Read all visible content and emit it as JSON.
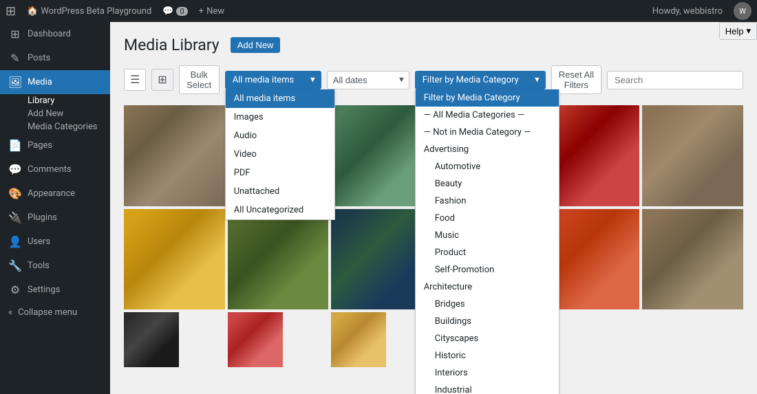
{
  "adminBar": {
    "siteIcon": "⊞",
    "siteName": "WordPress Beta Playground",
    "commentsLabel": "0",
    "newLabel": "New",
    "howdy": "Howdy, webbistro",
    "avatarInitial": "W"
  },
  "help": {
    "label": "Help",
    "arrow": "▾"
  },
  "page": {
    "title": "Media Library",
    "addNewLabel": "Add New"
  },
  "toolbar": {
    "listViewLabel": "≡",
    "gridViewLabel": "⊞",
    "bulkSelectLabel": "Bulk Select",
    "allMediaItems": "All media items",
    "allDates": "All dates",
    "filterByCategory": "Filter by Media Category",
    "resetFiltersLabel": "Reset All Filters",
    "searchPlaceholder": "Search"
  },
  "mediaItemsDropdown": {
    "items": [
      {
        "label": "All media items",
        "selected": true
      },
      {
        "label": "Images",
        "selected": false
      },
      {
        "label": "Audio",
        "selected": false
      },
      {
        "label": "Video",
        "selected": false
      },
      {
        "label": "PDF",
        "selected": false
      },
      {
        "label": "Unattached",
        "selected": false
      },
      {
        "label": "All Uncategorized",
        "selected": false
      }
    ]
  },
  "categoryDropdown": {
    "header": "Filter by Media Category",
    "items": [
      {
        "label": "— All Media Categories —",
        "type": "separator",
        "indent": false
      },
      {
        "label": "— Not in Media Category —",
        "type": "separator",
        "indent": false
      },
      {
        "label": "Advertising",
        "type": "category",
        "indent": false
      },
      {
        "label": "Automotive",
        "type": "category",
        "indent": true
      },
      {
        "label": "Beauty",
        "type": "category",
        "indent": true
      },
      {
        "label": "Fashion",
        "type": "category",
        "indent": true
      },
      {
        "label": "Food",
        "type": "category",
        "indent": true
      },
      {
        "label": "Music",
        "type": "category",
        "indent": true
      },
      {
        "label": "Product",
        "type": "category",
        "indent": true
      },
      {
        "label": "Self-Promotion",
        "type": "category",
        "indent": true
      },
      {
        "label": "Architecture",
        "type": "category",
        "indent": false
      },
      {
        "label": "Bridges",
        "type": "category",
        "indent": true
      },
      {
        "label": "Buildings",
        "type": "category",
        "indent": true
      },
      {
        "label": "Cityscapes",
        "type": "category",
        "indent": true
      },
      {
        "label": "Historic",
        "type": "category",
        "indent": true
      },
      {
        "label": "Interiors",
        "type": "category",
        "indent": true
      },
      {
        "label": "Industrial",
        "type": "category",
        "indent": true
      }
    ]
  },
  "sidebar": {
    "items": [
      {
        "label": "Dashboard",
        "icon": "⊞",
        "name": "dashboard",
        "active": false,
        "subs": []
      },
      {
        "label": "Posts",
        "icon": "✎",
        "name": "posts",
        "active": false,
        "subs": []
      },
      {
        "label": "Media",
        "icon": "🖼",
        "name": "media",
        "active": true,
        "subs": [
          {
            "label": "Library",
            "name": "library",
            "active": true
          },
          {
            "label": "Add New",
            "name": "add-new",
            "active": false
          },
          {
            "label": "Media Categories",
            "name": "media-categories",
            "active": false
          }
        ]
      },
      {
        "label": "Pages",
        "icon": "📄",
        "name": "pages",
        "active": false,
        "subs": []
      },
      {
        "label": "Comments",
        "icon": "💬",
        "name": "comments",
        "active": false,
        "subs": []
      },
      {
        "label": "Appearance",
        "icon": "🎨",
        "name": "appearance",
        "active": false,
        "subs": []
      },
      {
        "label": "Plugins",
        "icon": "🔌",
        "name": "plugins",
        "active": false,
        "subs": []
      },
      {
        "label": "Users",
        "icon": "👤",
        "name": "users",
        "active": false,
        "subs": []
      },
      {
        "label": "Tools",
        "icon": "🔧",
        "name": "tools",
        "active": false,
        "subs": []
      },
      {
        "label": "Settings",
        "icon": "⚙",
        "name": "settings",
        "active": false,
        "subs": []
      }
    ],
    "collapseLabel": "Collapse menu"
  },
  "mediaGrid": {
    "rows": [
      [
        "food-1",
        "food-2",
        "food-3",
        "food-4",
        "food-5",
        "food-6"
      ],
      [
        "food-7",
        "food-8",
        "food-9",
        "food-10",
        "food-11",
        "food-12"
      ],
      [
        "food-13",
        "food-14",
        "food-15",
        "food-16",
        "food-17",
        "food-18"
      ]
    ]
  }
}
